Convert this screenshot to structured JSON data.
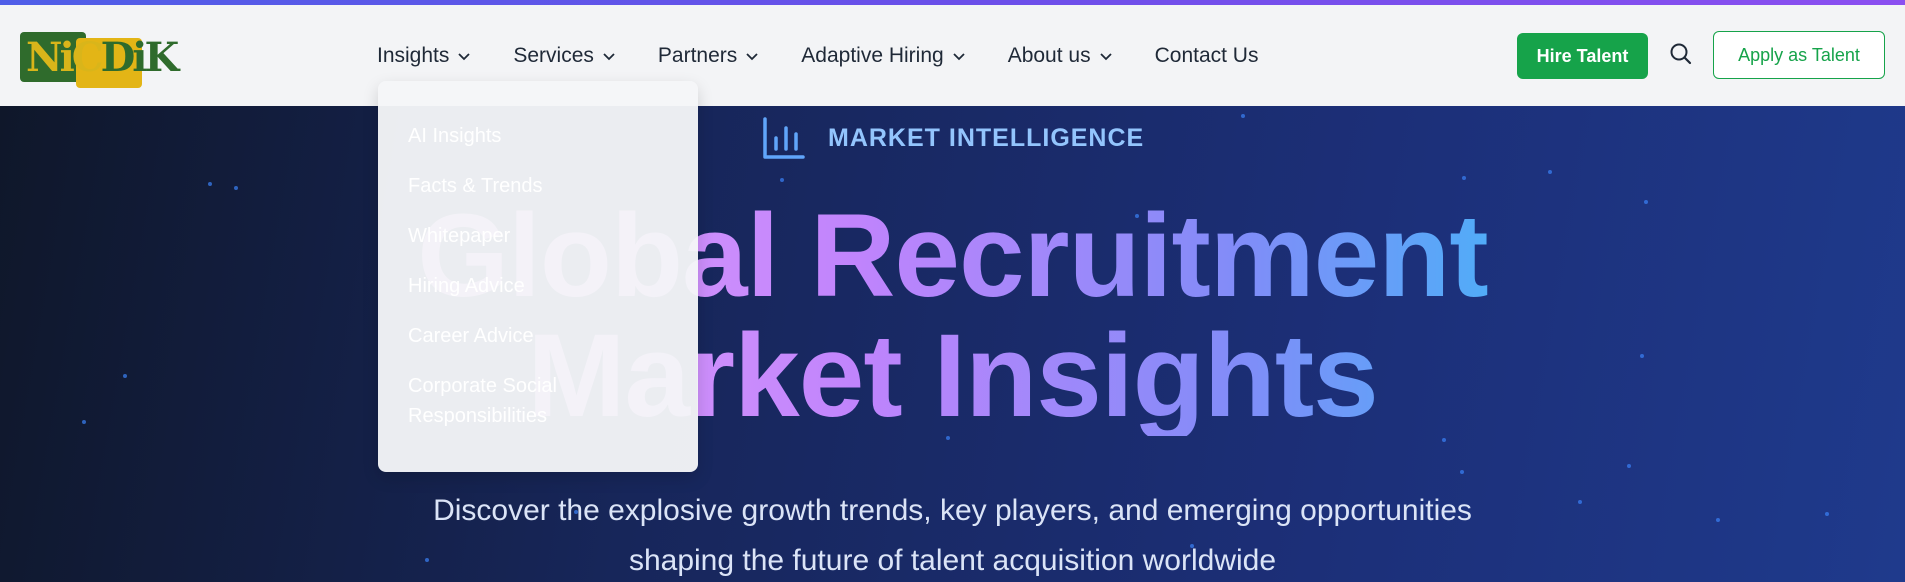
{
  "logo": {
    "text_a": "NiC",
    "text_b": "DiK"
  },
  "nav": {
    "items": [
      {
        "label": "Insights"
      },
      {
        "label": "Services"
      },
      {
        "label": "Partners"
      },
      {
        "label": "Adaptive Hiring"
      },
      {
        "label": "About us"
      },
      {
        "label": "Contact Us"
      }
    ]
  },
  "header": {
    "hire_label": "Hire Talent",
    "apply_label": "Apply as Talent",
    "search_icon": "search-icon"
  },
  "dropdown": {
    "items": [
      "AI Insights",
      "Facts & Trends",
      "Whitepaper",
      "Hiring Advice",
      "Career Advice",
      "Corporate Social Responsibilities"
    ]
  },
  "hero": {
    "eyebrow_icon": "bar-chart-icon",
    "eyebrow": "MARKET INTELLIGENCE",
    "headline_line1": "Global Recruitment",
    "headline_line2": "Market Insights",
    "subtext_line1": "Discover the explosive growth trends, key players, and emerging opportunities",
    "subtext_line2": "shaping the future of talent acquisition worldwide"
  },
  "colors": {
    "primary_green": "#16a34a",
    "hero_bg": "#1c2f78",
    "accent_blue": "#93c5fd"
  }
}
